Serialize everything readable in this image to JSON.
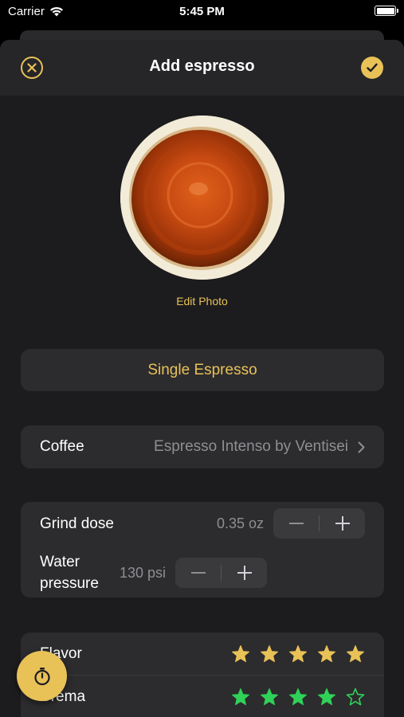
{
  "status_bar": {
    "carrier": "Carrier",
    "time": "5:45 PM"
  },
  "nav": {
    "title": "Add espresso",
    "close_icon": "close-circle-icon",
    "confirm_icon": "checkmark-icon"
  },
  "photo": {
    "edit_label": "Edit Photo"
  },
  "preset": {
    "label": "Single Espresso"
  },
  "coffee": {
    "label": "Coffee",
    "value": "Espresso Intenso by Ventisei"
  },
  "settings": [
    {
      "label": "Grind dose",
      "value": "0.35 oz"
    },
    {
      "label": "Water pressure",
      "value": "130 psi"
    }
  ],
  "ratings": [
    {
      "label": "Flavor",
      "score": 5,
      "max": 5,
      "color": "#e8c157"
    },
    {
      "label": "Crema",
      "score": 4,
      "max": 5,
      "color": "#30d158"
    }
  ],
  "colors": {
    "accent": "#e8c157",
    "crema_star": "#30d158",
    "background": "#1c1c1e",
    "card": "#2c2c2e"
  }
}
